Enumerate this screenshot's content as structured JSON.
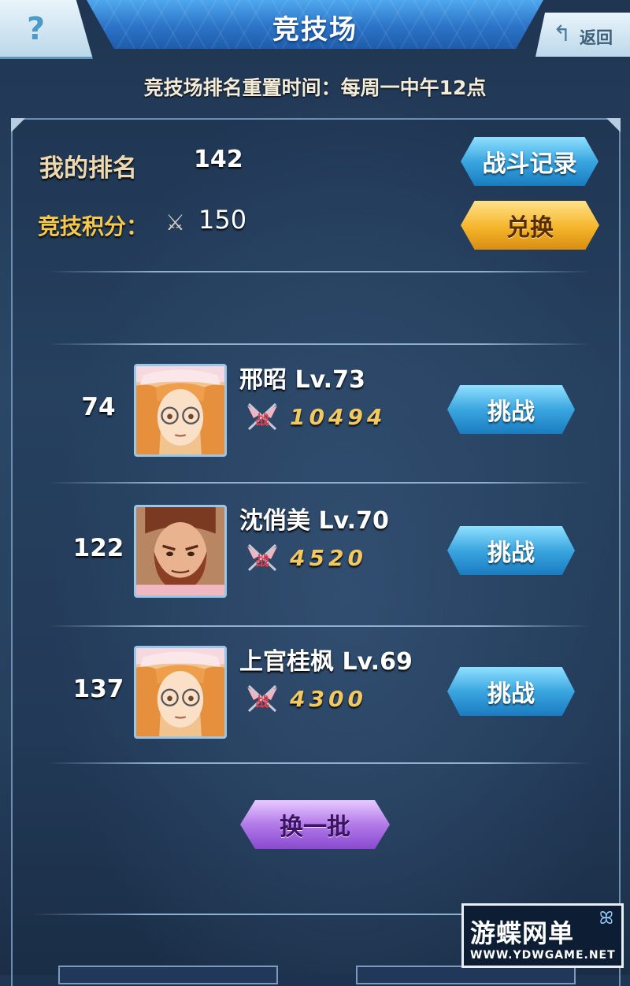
{
  "header": {
    "title": "竞技场",
    "help_icon": "?",
    "back_label": "返回",
    "back_icon": "↰"
  },
  "reset_info": "竞技场排名重置时间：每周一中午12点",
  "my_stats": {
    "rank_label": "我的排名",
    "rank_value": "142",
    "points_label": "竞技积分：",
    "points_icon": "crossed-swords-icon",
    "points_value": "150",
    "battle_log_label": "战斗记录",
    "exchange_label": "兑换"
  },
  "opponents": [
    {
      "rank": "74",
      "name": "邢昭 Lv.73",
      "power": "10494",
      "challenge_label": "挑战",
      "avatar": "glasses-girl"
    },
    {
      "rank": "122",
      "name": "沈俏美 Lv.70",
      "power": "4520",
      "challenge_label": "挑战",
      "avatar": "bearded-man"
    },
    {
      "rank": "137",
      "name": "上官桂枫 Lv.69",
      "power": "4300",
      "challenge_label": "挑战",
      "avatar": "glasses-girl"
    }
  ],
  "power_badge_text": "战",
  "refresh_label": "换一批",
  "watermark": {
    "title": "游蝶网单",
    "url": "WWW.YDWGAME.NET"
  },
  "colors": {
    "background": "#263f5d",
    "title_bar": "#2b73c7",
    "gold_text": "#f2c860",
    "button_blue": "#3aa6e0",
    "button_gold": "#f5b52a",
    "button_purple": "#b27ae8"
  }
}
